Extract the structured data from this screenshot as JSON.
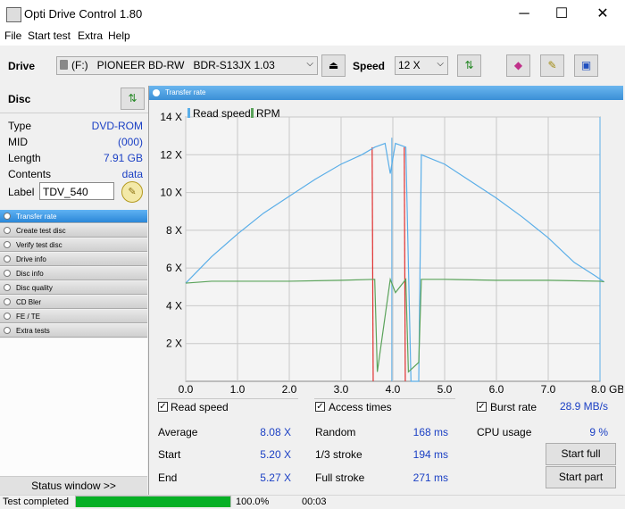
{
  "window": {
    "title": "Opti Drive Control 1.80",
    "minimize": "─",
    "maximize": "☐",
    "close": "✕"
  },
  "menu": [
    "File",
    "Start test",
    "Extra",
    "Help"
  ],
  "toolbar": {
    "drive_label": "Drive",
    "drive_value": "(F:)   PIONEER BD-RW   BDR-S13JX 1.03",
    "speed_label": "Speed",
    "speed_value": "12 X",
    "icons": [
      "eject-icon",
      "refresh-icon",
      "erase-icon",
      "options-icon",
      "save-icon"
    ]
  },
  "disc": {
    "heading": "Disc",
    "rows": [
      {
        "key": "Type",
        "value": "DVD-ROM"
      },
      {
        "key": "MID",
        "value": "(000)"
      },
      {
        "key": "Length",
        "value": "7.91 GB"
      },
      {
        "key": "Contents",
        "value": "data"
      }
    ],
    "label_key": "Label",
    "label_value": "TDV_540"
  },
  "nav": [
    {
      "label": "Transfer rate",
      "active": true
    },
    {
      "label": "Create test disc",
      "active": false
    },
    {
      "label": "Verify test disc",
      "active": false
    },
    {
      "label": "Drive info",
      "active": false
    },
    {
      "label": "Disc info",
      "active": false
    },
    {
      "label": "Disc quality",
      "active": false
    },
    {
      "label": "CD Bler",
      "active": false
    },
    {
      "label": "FE / TE",
      "active": false
    },
    {
      "label": "Extra tests",
      "active": false
    }
  ],
  "status_window": "Status window >>",
  "panel_title": "Transfer rate",
  "chart_data": {
    "type": "line",
    "legend": [
      "Read speed",
      "RPM"
    ],
    "legend_position": "top-left",
    "grid": true,
    "xlim": [
      0,
      8.0
    ],
    "ylim": [
      0,
      14
    ],
    "x_ticks": [
      "0.0",
      "1.0",
      "2.0",
      "3.0",
      "4.0",
      "5.0",
      "6.0",
      "7.0",
      "8.0 GB"
    ],
    "y_ticks": [
      "2 X",
      "4 X",
      "6 X",
      "8 X",
      "10 X",
      "12 X",
      "14 X"
    ],
    "colors": {
      "read_speed": "#5aaee8",
      "rpm": "#5aa35a",
      "access": "#e03030",
      "background": "#f4f4f4",
      "grid": "#c8c8c8"
    },
    "series": [
      {
        "name": "Read speed",
        "x": [
          0.0,
          0.5,
          1.0,
          1.5,
          2.0,
          2.5,
          3.0,
          3.4,
          3.65,
          3.75,
          3.85,
          3.95,
          4.05,
          4.15,
          4.25,
          4.35,
          4.5,
          4.55,
          5.0,
          5.5,
          6.0,
          6.5,
          7.0,
          7.5,
          7.9,
          8.08
        ],
        "y": [
          5.2,
          6.6,
          7.8,
          8.9,
          9.8,
          10.7,
          11.5,
          12.0,
          12.4,
          12.5,
          12.6,
          11.0,
          12.6,
          12.5,
          12.4,
          0.0,
          0.0,
          12.0,
          11.5,
          10.6,
          9.7,
          8.7,
          7.6,
          6.3,
          5.6,
          5.27
        ]
      },
      {
        "name": "RPM",
        "x": [
          0.0,
          0.5,
          1.0,
          2.0,
          3.0,
          3.65,
          3.7,
          3.95,
          4.05,
          4.25,
          4.3,
          4.5,
          4.55,
          5.0,
          6.0,
          7.0,
          8.0,
          8.08
        ],
        "y": [
          5.2,
          5.3,
          5.3,
          5.3,
          5.35,
          5.4,
          0.5,
          5.4,
          4.7,
          5.4,
          0.5,
          1.0,
          5.4,
          5.4,
          5.35,
          5.35,
          5.3,
          5.27
        ]
      }
    ]
  },
  "stats": {
    "read_speed_label": "Read speed",
    "access_times_label": "Access times",
    "burst_rate_label": "Burst rate",
    "burst_rate_value": "28.9 MB/s",
    "average_label": "Average",
    "average_value": "8.08 X",
    "start_label": "Start",
    "start_value": "5.20 X",
    "end_label": "End",
    "end_value": "5.27 X",
    "random_label": "Random",
    "random_value": "168 ms",
    "third_label": "1/3 stroke",
    "third_value": "194 ms",
    "full_label": "Full stroke",
    "full_value": "271 ms",
    "cpu_label": "CPU usage",
    "cpu_value": "9 %",
    "start_full": "Start full",
    "start_part": "Start part"
  },
  "statusbar": {
    "text": "Test completed",
    "progress": 1.0,
    "percent": "100.0%",
    "elapsed": "00:03"
  }
}
